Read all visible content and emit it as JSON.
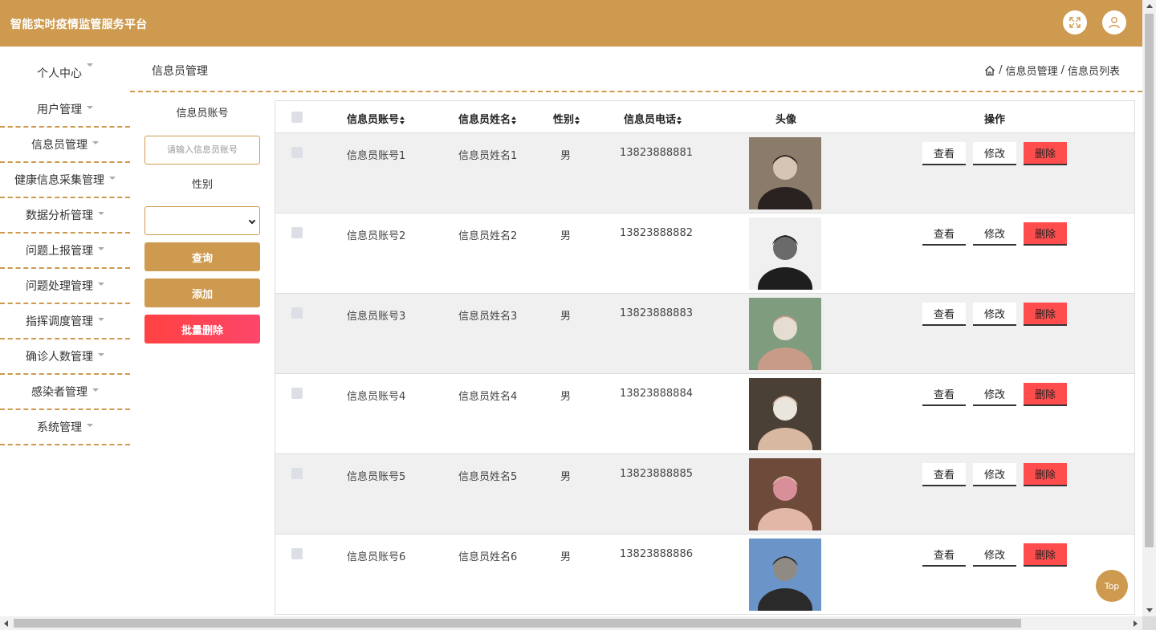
{
  "app": {
    "title": "智能实时疫情监管服务平台"
  },
  "header": {
    "icons": [
      "fullscreen-icon",
      "user-icon"
    ]
  },
  "sidebar": {
    "items": [
      {
        "label": "个人中心"
      },
      {
        "label": "用户管理"
      },
      {
        "label": "信息员管理"
      },
      {
        "label": "健康信息采集管理"
      },
      {
        "label": "数据分析管理"
      },
      {
        "label": "问题上报管理"
      },
      {
        "label": "问题处理管理"
      },
      {
        "label": "指挥调度管理"
      },
      {
        "label": "确诊人数管理"
      },
      {
        "label": "感染者管理"
      },
      {
        "label": "系统管理"
      }
    ]
  },
  "page": {
    "title": "信息员管理",
    "breadcrumb": [
      "信息员管理",
      "信息员列表"
    ],
    "breadcrumb_sep": "/"
  },
  "filters": {
    "account_label": "信息员账号",
    "account_placeholder": "请输入信息员账号",
    "gender_label": "性别",
    "gender_value": "",
    "query_label": "查询",
    "add_label": "添加",
    "batch_delete_label": "批量删除"
  },
  "table": {
    "headers": {
      "account": "信息员账号",
      "name": "信息员姓名",
      "gender": "性别",
      "phone": "信息员电话",
      "avatar": "头像",
      "actions": "操作"
    },
    "rows": [
      {
        "account": "信息员账号1",
        "name": "信息员姓名1",
        "gender": "男",
        "phone": "13823888881",
        "avatar_colors": [
          "#8b7b6a",
          "#2a2220",
          "#d7c5b3"
        ]
      },
      {
        "account": "信息员账号2",
        "name": "信息员姓名2",
        "gender": "男",
        "phone": "13823888882",
        "avatar_colors": [
          "#f0f0f0",
          "#1e1e1e",
          "#6a6a6a"
        ]
      },
      {
        "account": "信息员账号3",
        "name": "信息员姓名3",
        "gender": "男",
        "phone": "13823888883",
        "avatar_colors": [
          "#7f9c7f",
          "#c79b88",
          "#e6ddd2"
        ]
      },
      {
        "account": "信息员账号4",
        "name": "信息员姓名4",
        "gender": "男",
        "phone": "13823888884",
        "avatar_colors": [
          "#4a4036",
          "#d8b8a0",
          "#eae6dd"
        ]
      },
      {
        "account": "信息员账号5",
        "name": "信息员姓名5",
        "gender": "男",
        "phone": "13823888885",
        "avatar_colors": [
          "#6e4a3a",
          "#e3b7a7",
          "#d88f9a"
        ]
      },
      {
        "account": "信息员账号6",
        "name": "信息员姓名6",
        "gender": "男",
        "phone": "13823888886",
        "avatar_colors": [
          "#6b95c9",
          "#2a2a2a",
          "#8f8a83"
        ]
      }
    ],
    "actions": {
      "view": "查看",
      "edit": "修改",
      "delete": "删除"
    }
  },
  "back_to_top": "Top",
  "colors": {
    "brand": "#cd9a4f",
    "danger": "#ff4d4d",
    "stripe": "#f0f0f0"
  }
}
